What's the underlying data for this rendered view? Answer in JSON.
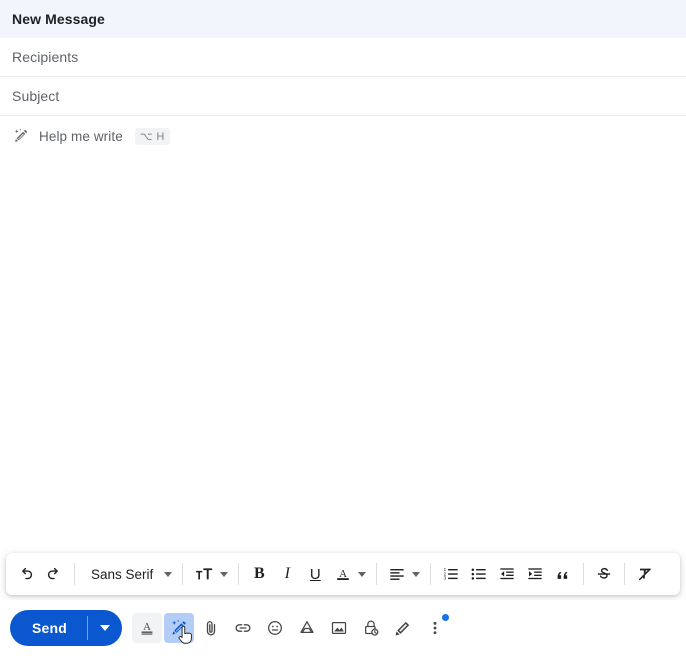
{
  "header": {
    "title": "New Message"
  },
  "fields": [
    {
      "name": "recipients",
      "placeholder": "Recipients",
      "value": ""
    },
    {
      "name": "subject",
      "placeholder": "Subject",
      "value": ""
    }
  ],
  "help_me_write": {
    "icon": "magic-pen-icon",
    "label": "Help me write",
    "shortcut": "⌥ H"
  },
  "body": {
    "value": "",
    "placeholder": ""
  },
  "format_toolbar": {
    "undo_label": "Undo",
    "redo_label": "Redo",
    "font_family": "Sans Serif",
    "font_size_label": "Size",
    "bold_label": "B",
    "italic_label": "I",
    "underline_label": "U",
    "text_color_label": "A",
    "align_label": "Align",
    "numbered_list_label": "Numbered list",
    "bulleted_list_label": "Bulleted list",
    "indent_less_label": "Indent less",
    "indent_more_label": "Indent more",
    "quote_label": "Quote",
    "strikethrough_label": "Strikethrough",
    "remove_formatting_label": "Remove formatting"
  },
  "action_bar": {
    "send_label": "Send",
    "send_options_label": "More send options",
    "formatting_options_label": "Formatting options",
    "help_me_write_label": "Help me write",
    "attach_label": "Attach files",
    "link_label": "Insert link",
    "emoji_label": "Insert emoji",
    "drive_label": "Insert files using Drive",
    "photo_label": "Insert photo",
    "confidential_label": "Toggle confidential mode",
    "signature_label": "Insert signature",
    "more_label": "More options"
  },
  "colors": {
    "header_bg": "#f2f6fc",
    "send_blue": "#0b57d0",
    "active_chip_blue": "#b3cdf7",
    "active_chip_grey": "#f1f3f4",
    "badge_blue": "#1a73e8",
    "text_primary": "#202124",
    "text_secondary": "#5f6368",
    "divider": "#e8eaed"
  }
}
